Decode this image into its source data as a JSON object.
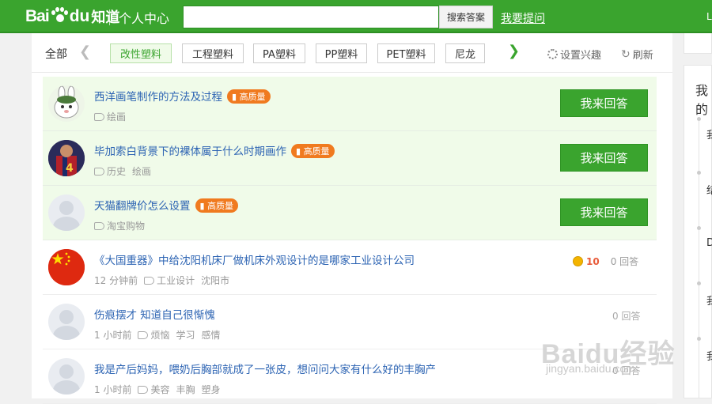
{
  "header": {
    "logo_bai": "Bai",
    "logo_du": "du",
    "logo_product": "知道",
    "personal_center": "个人中心",
    "search_placeholder": "",
    "search_button": "搜索答案",
    "ask_link": "我要提问",
    "user_stub": "L"
  },
  "tagbar": {
    "all_label": "全部",
    "tags": [
      {
        "label": "改性塑料",
        "active": true
      },
      {
        "label": "工程塑料",
        "active": false
      },
      {
        "label": "PA塑料",
        "active": false
      },
      {
        "label": "PP塑料",
        "active": false
      },
      {
        "label": "PET塑料",
        "active": false
      },
      {
        "label": "尼龙",
        "active": false
      }
    ],
    "set_interest": "设置兴趣",
    "refresh": "刷新"
  },
  "questions": [
    {
      "title": "西洋画笔制作的方法及过程",
      "badge": "高质量",
      "time": "",
      "tags": [
        "绘画"
      ],
      "action": "我来回答",
      "avatar": "rabbit-avatar"
    },
    {
      "title": "毕加索白背景下的裸体属于什么时期画作",
      "badge": "高质量",
      "time": "",
      "tags": [
        "历史",
        "绘画"
      ],
      "action": "我来回答",
      "avatar": "player-avatar"
    },
    {
      "title": "天猫翻牌价怎么设置",
      "badge": "高质量",
      "time": "",
      "tags": [
        "淘宝购物"
      ],
      "action": "我来回答",
      "avatar": "default-avatar"
    },
    {
      "title": "《大国重器》中给沈阳机床厂做机床外观设计的是哪家工业设计公司",
      "badge": "",
      "time": "12 分钟前",
      "tags": [
        "工业设计",
        "沈阳市"
      ],
      "reward": "10",
      "answers": "0 回答",
      "avatar": "flag-avatar"
    },
    {
      "title": "伤痕摆才 知道自己很惭愧",
      "badge": "",
      "time": "1 小时前",
      "tags": [
        "烦恼",
        "学习",
        "感情"
      ],
      "answers": "0 回答",
      "avatar": "default-avatar"
    },
    {
      "title": "我是产后妈妈，喂奶后胸部就成了一张皮，想问问大家有什么好的丰胸产",
      "badge": "",
      "time": "1 小时前",
      "tags": [
        "美容",
        "丰胸",
        "塑身"
      ],
      "answers": "0 回答",
      "avatar": "default-avatar"
    }
  ],
  "right_panel": {
    "title_partial": "我的",
    "items_partial": [
      "我",
      "结",
      "D",
      "我",
      "我"
    ]
  },
  "watermark": {
    "main": "Baidu经验",
    "sub": "jingyan.baidu.com"
  },
  "colors": {
    "brand_green": "#3aa42e",
    "highlight_row": "#f0fbe9",
    "link_blue": "#2d64b3",
    "badge_orange": "#f07a1f"
  }
}
